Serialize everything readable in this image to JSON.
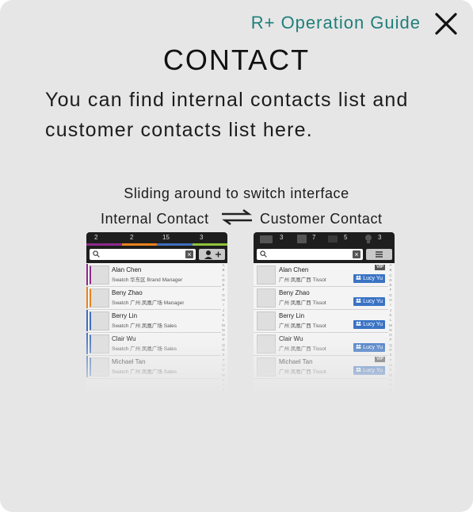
{
  "header": {
    "guide_title": "R+ Operation Guide"
  },
  "page": {
    "title": "CONTACT",
    "description": "You can find internal contacts list and customer contacts list here.",
    "sliding_hint": "Sliding around to switch interface",
    "label_internal": "Internal Contact",
    "label_customer": "Customer Contact"
  },
  "colors": {
    "accent": "#1f7f7a",
    "background": "#e6e6e6",
    "rep_badge": "#3a73c4"
  },
  "internal": {
    "counts": [
      "2",
      "2",
      "15",
      "3"
    ],
    "strip_colors": [
      "#8e2a8c",
      "#e8821e",
      "#3f6fbd",
      "#8fc43a"
    ],
    "contacts": [
      {
        "name": "Alan Chen",
        "sub": "Swatch 华东区 Brand Manager",
        "color": "#8e2a8c"
      },
      {
        "name": "Beny Zhao",
        "sub": "Swatch 广州 凤凰广场 Manager",
        "color": "#e8821e"
      },
      {
        "name": "Berry Lin",
        "sub": "Swatch 广州 凤凰广场 Sales",
        "color": "#3f6fbd"
      },
      {
        "name": "Clair Wu",
        "sub": "Swatch 广州 凤凰广场 Sales",
        "color": "#3f6fbd"
      },
      {
        "name": "Michael Tan",
        "sub": "Swatch 广州 凤凰广场 Sales",
        "color": "#3f6fbd"
      }
    ]
  },
  "customer": {
    "vip_label": "VIP",
    "counts": [
      "3",
      "7",
      "5",
      "3"
    ],
    "contacts": [
      {
        "name": "Alan Chen",
        "sub": "广州 凤凰广西 Tissot",
        "rep": "Lucy Yu",
        "vip": true
      },
      {
        "name": "Beny Zhao",
        "sub": "广州 凤凰广西 Tissot",
        "rep": "Lucy Yu",
        "vip": false
      },
      {
        "name": "Berry Lin",
        "sub": "广州 凤凰广西 Tissot",
        "rep": "Lucy Yu",
        "vip": false
      },
      {
        "name": "Clair Wu",
        "sub": "广州 凤凰广西 Tissot",
        "rep": "Lucy Yu",
        "vip": false
      },
      {
        "name": "Michael Tan",
        "sub": "广州 凤凰广西 Tissot",
        "rep": "Lucy Yu",
        "vip": true
      }
    ]
  },
  "index_letters": [
    "A",
    "B",
    "C",
    "D",
    "E",
    "F",
    "G",
    "H",
    "I",
    "J",
    "K",
    "L",
    "M",
    "N",
    "O",
    "P",
    "Q",
    "R",
    "S",
    "T",
    "U",
    "V",
    "W",
    "X",
    "Y",
    "Z"
  ]
}
